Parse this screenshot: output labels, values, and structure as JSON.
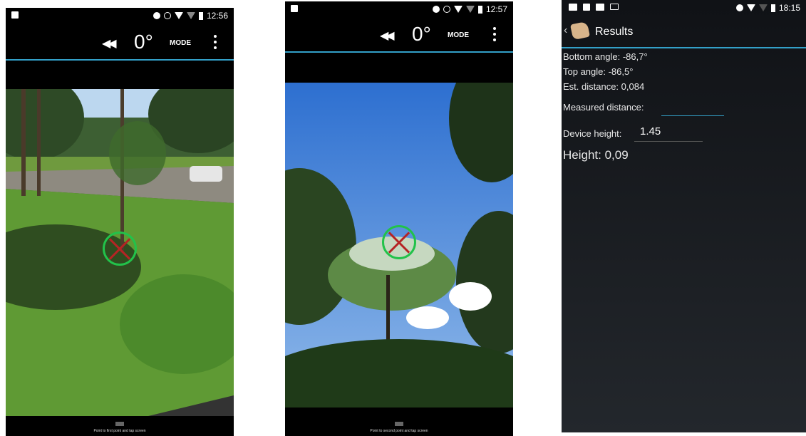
{
  "screen1": {
    "time": "12:56",
    "angle": "0°",
    "mode_label": "MODE",
    "hint": "Point to first point and tap screen"
  },
  "screen2": {
    "time": "12:57",
    "angle": "0°",
    "mode_label": "MODE",
    "hint": "Point to second point and tap screen"
  },
  "screen3": {
    "time": "18:15",
    "title": "Results",
    "bottom_angle": "Bottom angle: -86,7°",
    "top_angle": "Top angle: -86,5°",
    "est_distance": "Est. distance: 0,084",
    "measured_distance_label": "Measured distance:",
    "measured_distance_value": "",
    "device_height_label": "Device height:",
    "device_height_value": "1.45",
    "height": "Height: 0,09"
  },
  "colors": {
    "accent_line": "#33a0c8",
    "reticle_ring": "#22c24a",
    "reticle_cross": "#b52424"
  }
}
